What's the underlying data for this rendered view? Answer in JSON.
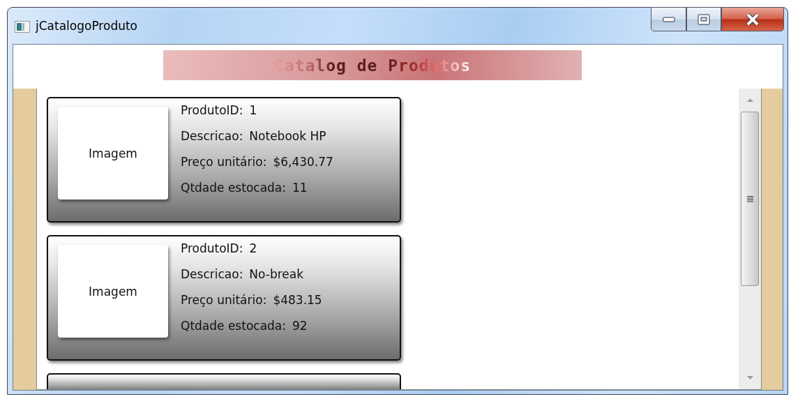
{
  "window": {
    "title": "jCatalogoProduto"
  },
  "header": {
    "title": "Catalog de Produtos"
  },
  "products": [
    {
      "image_label": "Imagem",
      "fields": [
        {
          "label": "ProdutoID:",
          "value": "1"
        },
        {
          "label": "Descricao:",
          "value": "Notebook HP"
        },
        {
          "label": "Preço unitário:",
          "value": "$6,430.77"
        },
        {
          "label": "Qtdade estocada:",
          "value": "11"
        }
      ]
    },
    {
      "image_label": "Imagem",
      "fields": [
        {
          "label": "ProdutoID:",
          "value": "2"
        },
        {
          "label": "Descricao:",
          "value": "No-break"
        },
        {
          "label": "Preço unitário:",
          "value": "$483.15"
        },
        {
          "label": "Qtdade estocada:",
          "value": "92"
        }
      ]
    },
    {
      "kind": "partial"
    }
  ]
}
